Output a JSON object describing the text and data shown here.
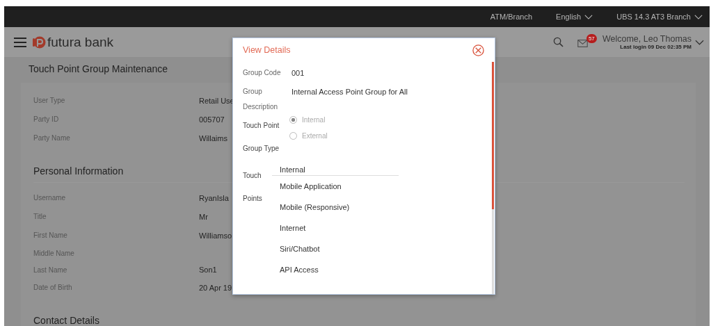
{
  "top_bar": {
    "items": [
      {
        "label": "ATM/Branch",
        "kind": "link"
      },
      {
        "label": "English",
        "kind": "dropdown"
      },
      {
        "label": "UBS 14.3 AT3 Branch",
        "kind": "dropdown"
      }
    ]
  },
  "header": {
    "brand": "futura bank",
    "notification_count": "57",
    "welcome": "Welcome, Leo Thomas",
    "last_login": "Last login 09 Dec 02:35 PM"
  },
  "page": {
    "title": "Touch Point Group Maintenance",
    "sections": [
      {
        "rows": [
          {
            "label": "User Type",
            "value": "Retail Use"
          },
          {
            "label": "Party ID",
            "value": "005707"
          },
          {
            "label": "Party Name",
            "value": "Willaims"
          }
        ]
      },
      {
        "title": "Personal Information",
        "rows": [
          {
            "label": "Username",
            "value": "RyanIsla"
          },
          {
            "label": "Title",
            "value": "Mr"
          },
          {
            "label": "First Name",
            "value": "Williamso"
          },
          {
            "label": "Middle Name",
            "value": ""
          },
          {
            "label": "Last Name",
            "value": "Son1"
          },
          {
            "label": "Date of Birth",
            "value": "20 Apr 19"
          }
        ]
      },
      {
        "title": "Contact Details"
      }
    ]
  },
  "modal": {
    "title": "View Details",
    "fields": [
      {
        "kind": "text",
        "label": "Group Code",
        "value": "001"
      },
      {
        "kind": "text",
        "label": "Group Description",
        "value": "Internal Access Point Group for All"
      },
      {
        "kind": "radio",
        "label": "Touch Point Group Type",
        "disabled": true,
        "options": [
          {
            "label": "Internal",
            "selected": true
          },
          {
            "label": "External",
            "selected": false
          }
        ]
      },
      {
        "kind": "list",
        "label": "Touch Points",
        "items": [
          "Internal",
          "Mobile Application",
          "Mobile (Responsive)",
          "Internet",
          "Siri/Chatbot",
          "API Access"
        ]
      }
    ]
  }
}
